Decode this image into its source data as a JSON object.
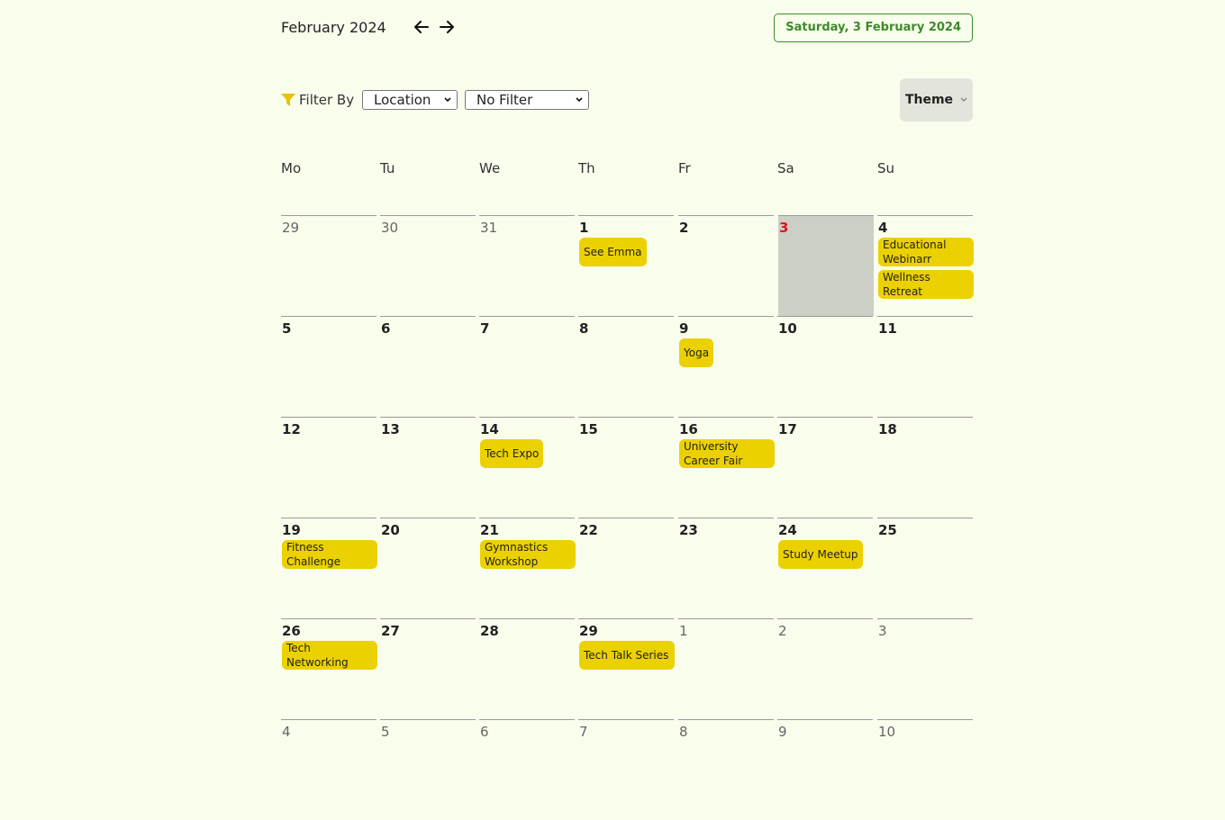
{
  "header": {
    "month_title": "February 2024",
    "prev_icon": "arrow-left-icon",
    "next_icon": "arrow-right-icon",
    "today_label": "Saturday, 3 February 2024"
  },
  "filter": {
    "icon": "funnel-icon",
    "label": "Filter By",
    "field_value": "Location",
    "value_value": "No Filter"
  },
  "theme": {
    "label": "Theme"
  },
  "weekdays": [
    "Mo",
    "Tu",
    "We",
    "Th",
    "Fr",
    "Sa",
    "Su"
  ],
  "colors": {
    "background": "#f9fdec",
    "accent_green": "#3d8b2a",
    "event_yellow": "#ecd100",
    "selected_cell": "#cccfc6",
    "today_red": "#e0141e",
    "filter_icon": "#e8c400"
  },
  "weeks": [
    [
      {
        "day": "29",
        "other": true,
        "events": []
      },
      {
        "day": "30",
        "other": true,
        "events": []
      },
      {
        "day": "31",
        "other": true,
        "events": []
      },
      {
        "day": "1",
        "events": [
          "See Emma"
        ]
      },
      {
        "day": "2",
        "events": []
      },
      {
        "day": "3",
        "today": true,
        "selected": true,
        "events": []
      },
      {
        "day": "4",
        "events": [
          "Educational Webinarr",
          "Wellness Retreat"
        ]
      }
    ],
    [
      {
        "day": "5",
        "events": []
      },
      {
        "day": "6",
        "events": []
      },
      {
        "day": "7",
        "events": []
      },
      {
        "day": "8",
        "events": []
      },
      {
        "day": "9",
        "events": [
          "Yoga"
        ]
      },
      {
        "day": "10",
        "events": []
      },
      {
        "day": "11",
        "events": []
      }
    ],
    [
      {
        "day": "12",
        "events": []
      },
      {
        "day": "13",
        "events": []
      },
      {
        "day": "14",
        "events": [
          "Tech Expo"
        ]
      },
      {
        "day": "15",
        "events": []
      },
      {
        "day": "16",
        "events": [
          "University Career Fair"
        ]
      },
      {
        "day": "17",
        "events": []
      },
      {
        "day": "18",
        "events": []
      }
    ],
    [
      {
        "day": "19",
        "events": [
          "Fitness Challenge"
        ]
      },
      {
        "day": "20",
        "events": []
      },
      {
        "day": "21",
        "events": [
          "Gymnastics Workshop"
        ]
      },
      {
        "day": "22",
        "events": []
      },
      {
        "day": "23",
        "events": []
      },
      {
        "day": "24",
        "events": [
          "Study Meetup"
        ]
      },
      {
        "day": "25",
        "events": []
      }
    ],
    [
      {
        "day": "26",
        "events": [
          "Tech Networking"
        ]
      },
      {
        "day": "27",
        "events": []
      },
      {
        "day": "28",
        "events": []
      },
      {
        "day": "29",
        "events": [
          "Tech Talk Series"
        ]
      },
      {
        "day": "1",
        "other": true,
        "events": []
      },
      {
        "day": "2",
        "other": true,
        "events": []
      },
      {
        "day": "3",
        "other": true,
        "events": []
      }
    ],
    [
      {
        "day": "4",
        "other": true,
        "events": []
      },
      {
        "day": "5",
        "other": true,
        "events": []
      },
      {
        "day": "6",
        "other": true,
        "events": []
      },
      {
        "day": "7",
        "other": true,
        "events": []
      },
      {
        "day": "8",
        "other": true,
        "events": []
      },
      {
        "day": "9",
        "other": true,
        "events": []
      },
      {
        "day": "10",
        "other": true,
        "events": []
      }
    ]
  ]
}
